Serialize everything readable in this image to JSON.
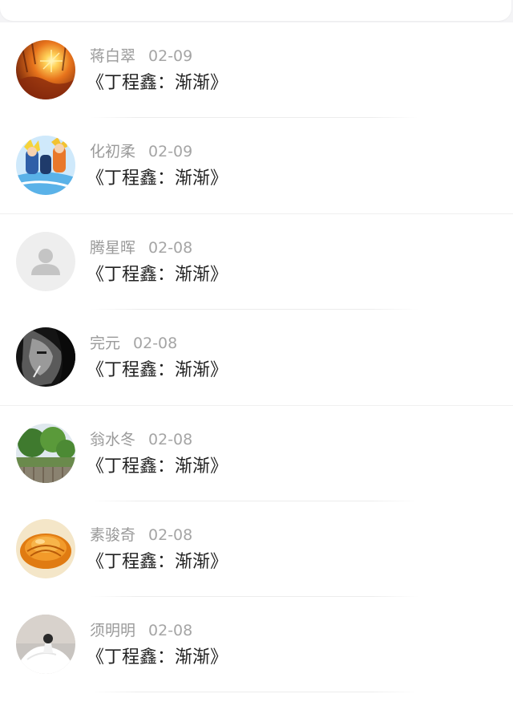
{
  "header": {
    "back_icon": "chevron-left-icon",
    "accent_color": "#3b9cf5"
  },
  "comments": [
    {
      "name": "蒋白翠",
      "date": "02-09",
      "text": "《丁程鑫：渐渐》",
      "avatar": "sunset-autumn-avatar"
    },
    {
      "name": "化初柔",
      "date": "02-09",
      "text": "《丁程鑫：渐渐》",
      "avatar": "anime-characters-avatar"
    },
    {
      "name": "腾星晖",
      "date": "02-08",
      "text": "《丁程鑫：渐渐》",
      "avatar": "default-user-avatar"
    },
    {
      "name": "完元",
      "date": "02-08",
      "text": "《丁程鑫：渐渐》",
      "avatar": "monochrome-portrait-avatar"
    },
    {
      "name": "翁水冬",
      "date": "02-08",
      "text": "《丁程鑫：渐渐》",
      "avatar": "trees-landscape-avatar"
    },
    {
      "name": "素骏奇",
      "date": "02-08",
      "text": "《丁程鑫：渐渐》",
      "avatar": "amber-food-avatar"
    },
    {
      "name": "须明明",
      "date": "02-08",
      "text": "《丁程鑫：渐渐》",
      "avatar": "wedding-dress-avatar"
    }
  ]
}
